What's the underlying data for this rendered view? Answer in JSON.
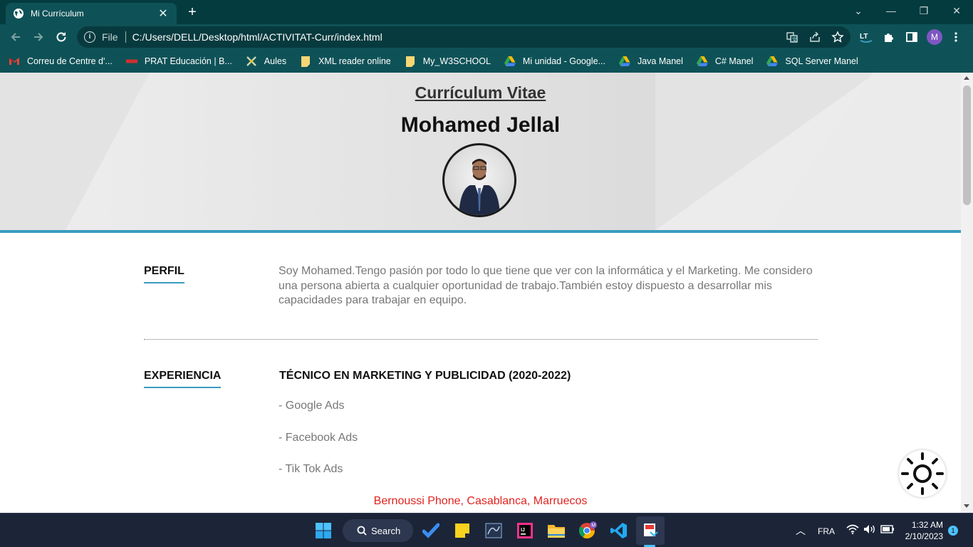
{
  "browser": {
    "tab_title": "Mi Currículum",
    "url_scheme": "File",
    "url": "C:/Users/DELL/Desktop/html/ACTIVITAT-Curr/index.html",
    "profile_initial": "M",
    "bookmarks": [
      {
        "label": "Correu de Centre d'...",
        "icon": "gmail-icon"
      },
      {
        "label": "PRAT Educación | B...",
        "icon": "prat-icon"
      },
      {
        "label": "Aules",
        "icon": "aules-icon"
      },
      {
        "label": "XML reader online",
        "icon": "note-icon"
      },
      {
        "label": "My_W3SCHOOL",
        "icon": "note-icon"
      },
      {
        "label": "Mi unidad - Google...",
        "icon": "drive-icon"
      },
      {
        "label": "Java Manel",
        "icon": "drive-icon"
      },
      {
        "label": "C# Manel",
        "icon": "drive-icon"
      },
      {
        "label": "SQL Server Manel",
        "icon": "drive-icon"
      }
    ]
  },
  "page": {
    "title": "Currículum Vitae",
    "name": "Mohamed Jellal",
    "profile_label": "PERFIL",
    "profile_text": "Soy Mohamed.Tengo pasión por todo lo que tiene que ver con la informática y el Marketing. Me considero una persona abierta a cualquier oportunidad de trabajo.También estoy dispuesto a desarrollar mis capacidades para trabajar en equipo.",
    "experience_label": "EXPERIENCIA",
    "job_title": "TÉCNICO EN MARKETING Y PUBLICIDAD (2020-2022)",
    "job_items": [
      "- Google Ads",
      "- Facebook Ads",
      "- Tik Tok Ads"
    ],
    "location": "Bernoussi Phone, Casablanca, Marruecos",
    "colors": {
      "accent": "#3b9bbf",
      "location": "#e0231f",
      "chrome": "#0e5257"
    }
  },
  "taskbar": {
    "search_label": "Search",
    "language": "FRA",
    "time": "1:32 AM",
    "date": "2/10/2023",
    "notification_count": "1"
  }
}
